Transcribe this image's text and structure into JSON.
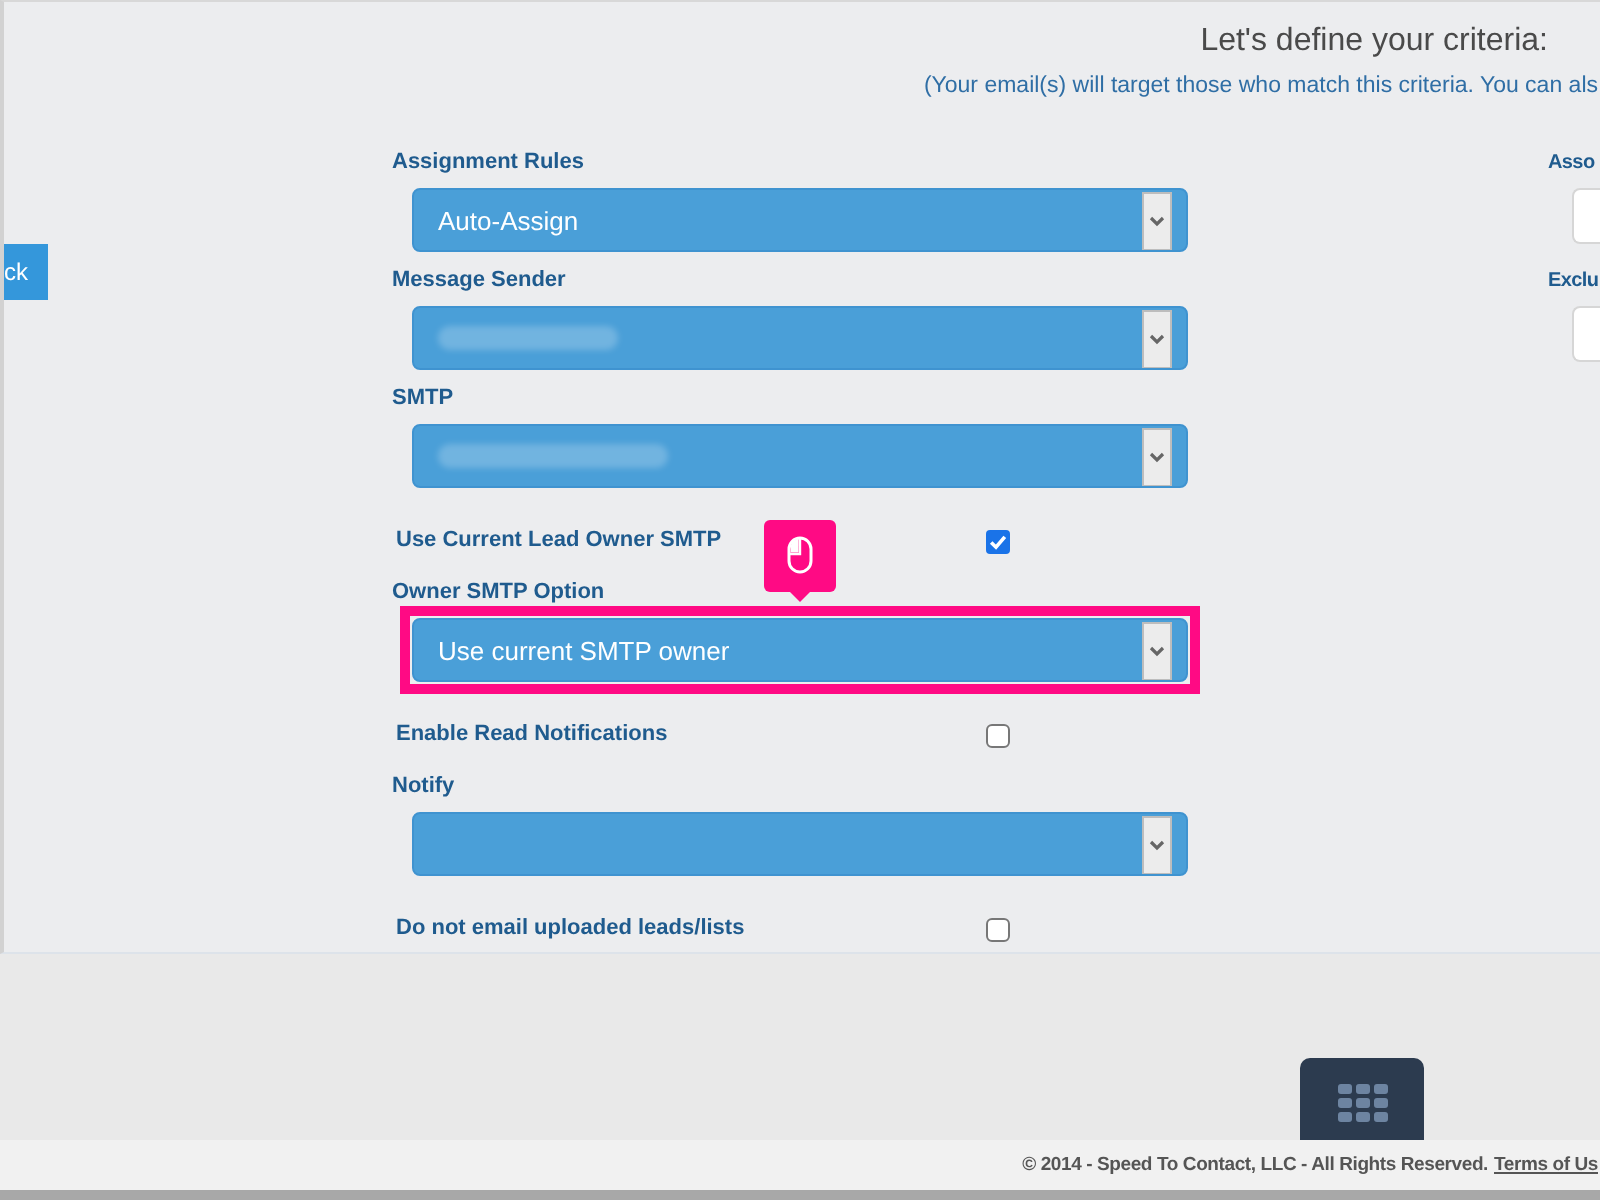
{
  "header": {
    "title": "Let's define your criteria:",
    "subtitle": "(Your email(s) will target those who match this criteria. You can als"
  },
  "back_button": {
    "label": "ck"
  },
  "fields": [
    {
      "kind": "select",
      "label": "Assignment Rules",
      "value": "Auto-Assign",
      "blurred": false,
      "highlighted": false
    },
    {
      "kind": "select",
      "label": "Message Sender",
      "blurred": true,
      "highlighted": false
    },
    {
      "kind": "select",
      "label": "SMTP",
      "blurred": true,
      "highlighted": false
    },
    {
      "kind": "checkbox",
      "label": "Use Current Lead Owner SMTP",
      "checked": true
    },
    {
      "kind": "select",
      "label": "Owner SMTP Option",
      "value": "Use current SMTP owner",
      "blurred": false,
      "highlighted": true
    },
    {
      "kind": "checkbox",
      "label": "Enable Read Notifications",
      "checked": false
    },
    {
      "kind": "select",
      "label": "Notify",
      "blurred": false,
      "highlighted": false
    },
    {
      "kind": "checkbox",
      "label": "Do not email uploaded leads/lists",
      "checked": false
    }
  ],
  "side_fields": [
    {
      "label": "Asso"
    },
    {
      "label": "Exclu"
    }
  ],
  "footer": {
    "copyright": "© 2014 - Speed To Contact, LLC - All Rights Reserved.",
    "link": "Terms of Us"
  }
}
